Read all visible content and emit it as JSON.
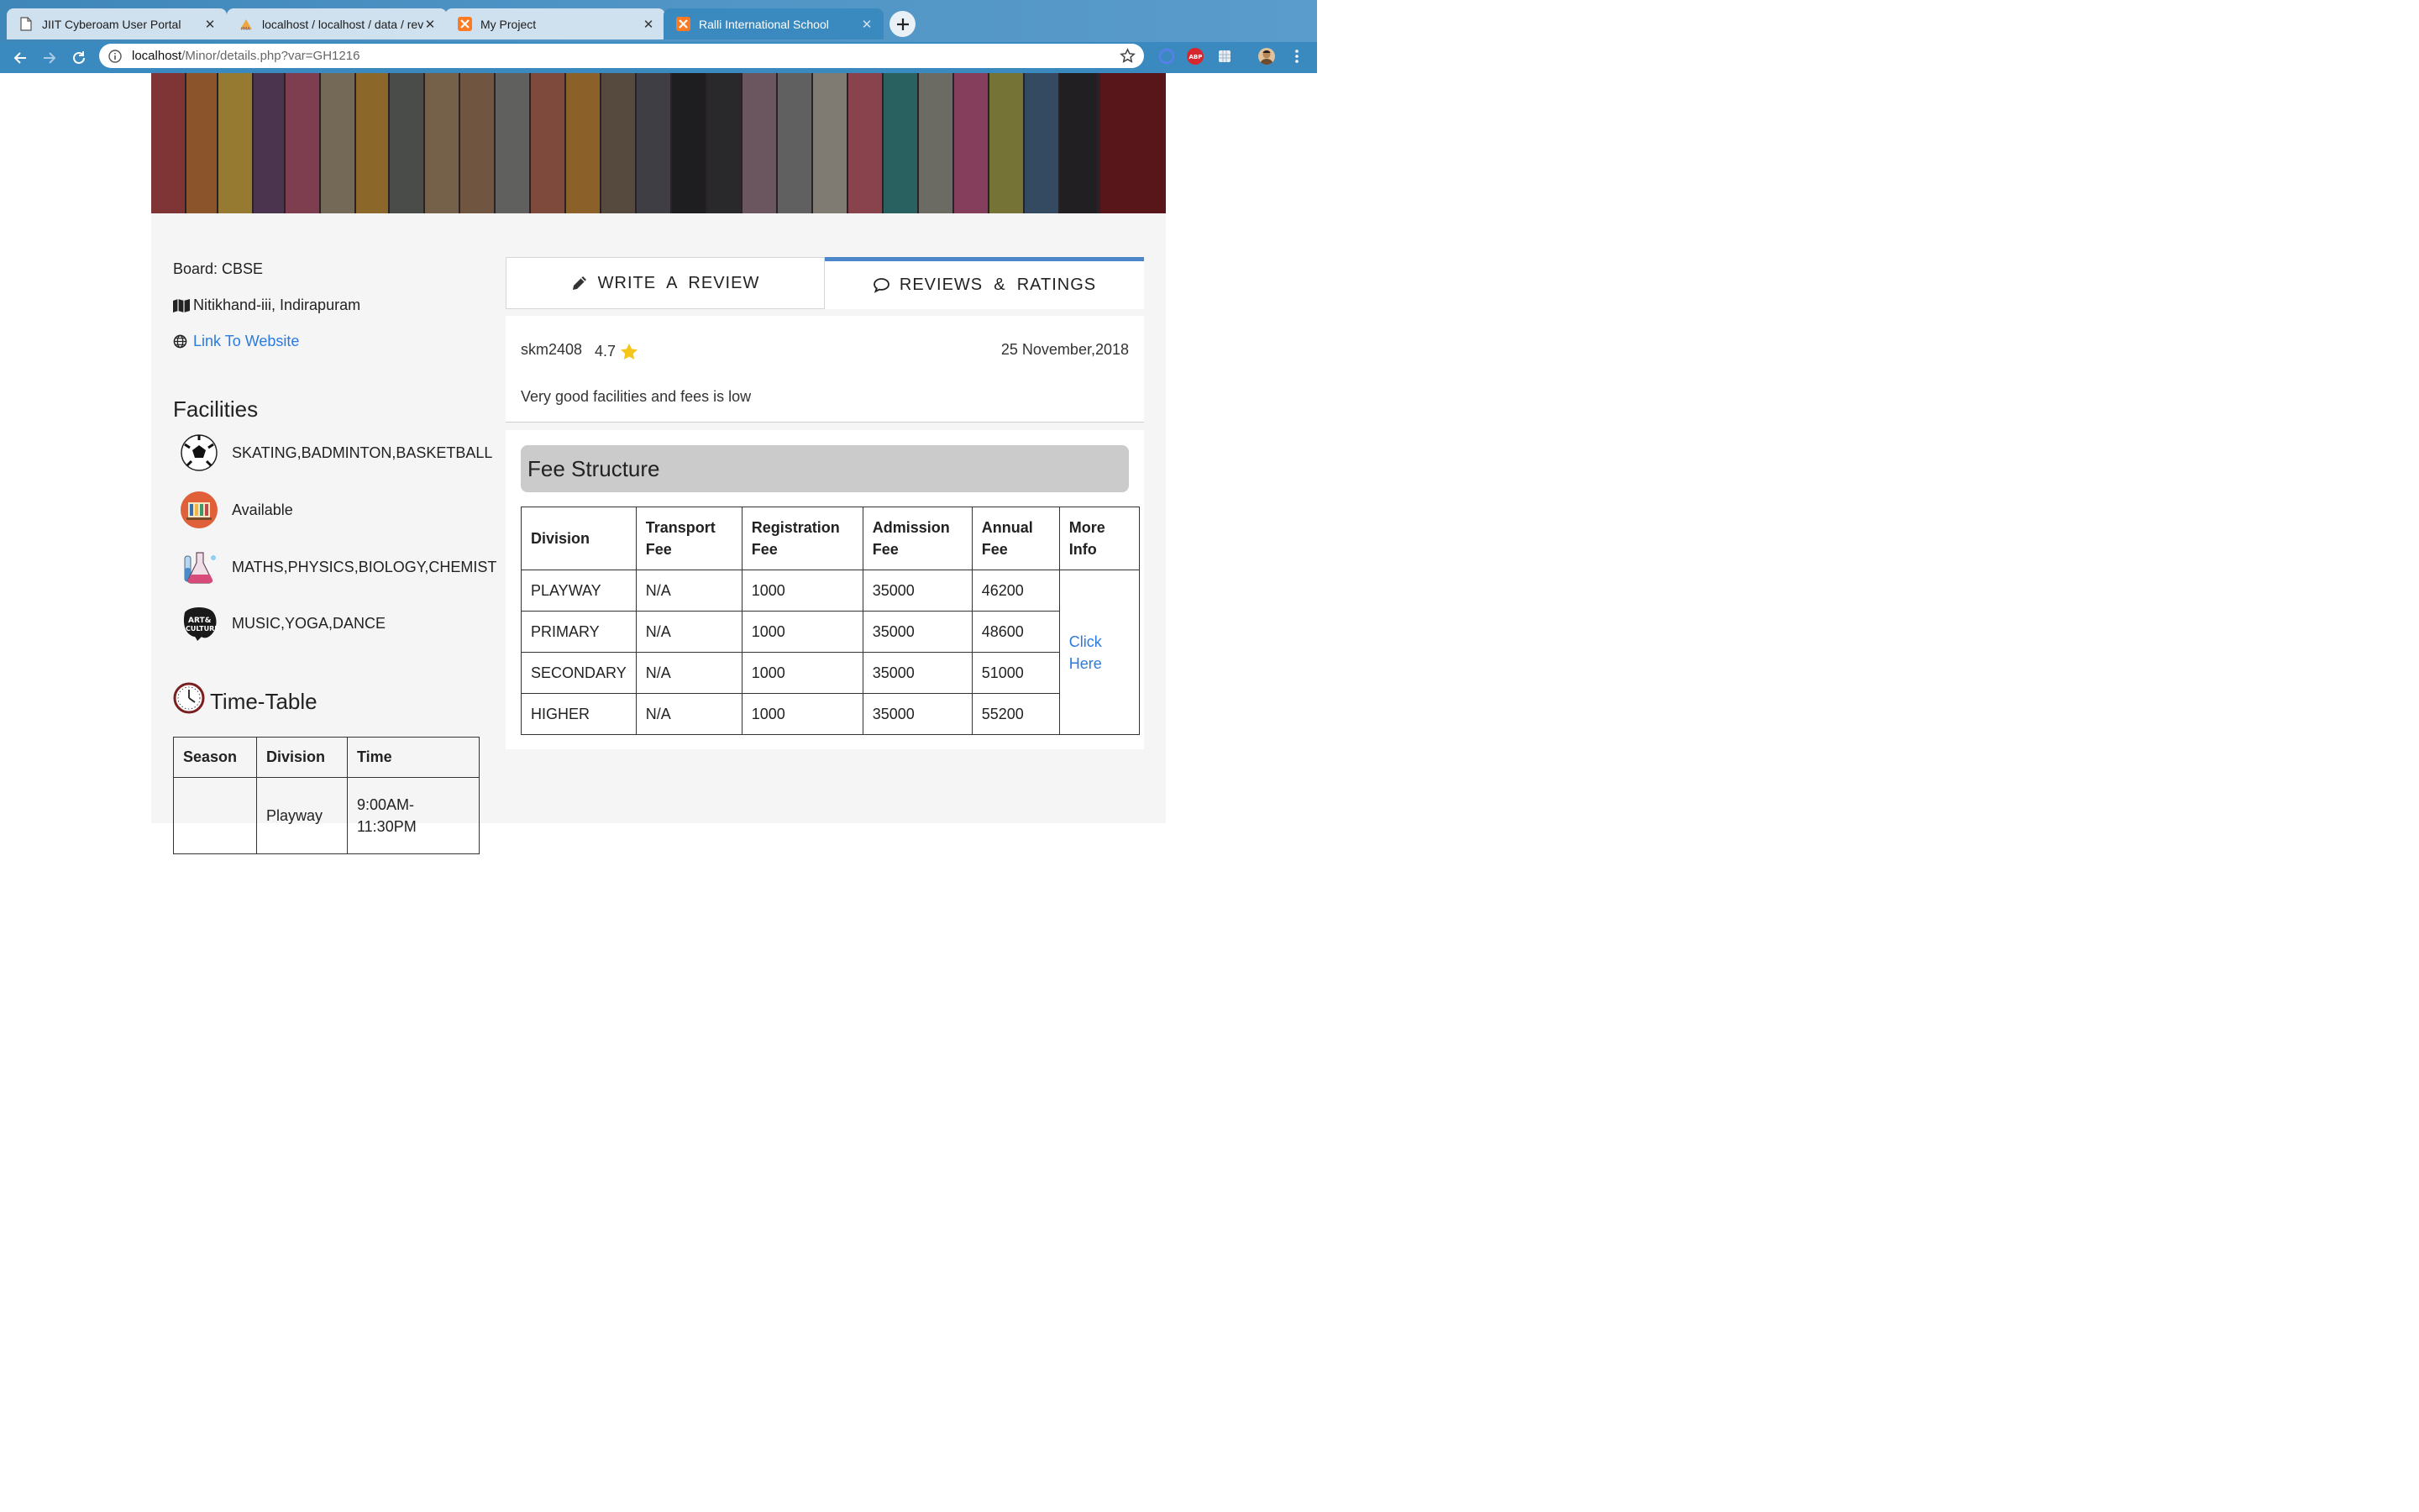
{
  "browser": {
    "tabs": [
      {
        "title": "JIIT Cyberoam User Portal",
        "icon": "document-icon"
      },
      {
        "title": "localhost / localhost / data / rev",
        "icon": "phpmyadmin-icon"
      },
      {
        "title": "My Project",
        "icon": "xampp-icon"
      },
      {
        "title": "Ralli International School",
        "icon": "xampp-icon",
        "active": true
      }
    ],
    "url_host": "localhost",
    "url_rest": "/Minor/details.php?var=GH1216"
  },
  "school": {
    "board": "Board: CBSE",
    "address": "Nitikhand-iii, Indirapuram",
    "website_link": "Link To Website"
  },
  "facilities": {
    "heading": "Facilities",
    "items": [
      {
        "icon": "football-icon",
        "text": "SKATING,BADMINTON,BASKETBALL"
      },
      {
        "icon": "library-icon",
        "text": "Available"
      },
      {
        "icon": "lab-flask-icon",
        "text": "MATHS,PHYSICS,BIOLOGY,CHEMIST"
      },
      {
        "icon": "art-culture-icon",
        "text": "MUSIC,YOGA,DANCE"
      }
    ]
  },
  "timetable": {
    "heading": "Time-Table",
    "headers": [
      "Season",
      "Division",
      "Time"
    ],
    "rows": [
      [
        "",
        "Playway",
        "9:00AM-11:30PM"
      ]
    ]
  },
  "review_tabs": {
    "write": "WRITE  A  REVIEW",
    "reviews": "REVIEWS  &  RATINGS"
  },
  "review": {
    "user": "skm2408",
    "rating": "4.7",
    "date": "25 November,2018",
    "text": "Very good facilities and fees is low"
  },
  "fees": {
    "heading": "Fee Structure",
    "headers": [
      "Division",
      "Transport Fee",
      "Registration Fee",
      "Admission Fee",
      "Annual Fee",
      "More Info"
    ],
    "rows": [
      [
        "PLAYWAY",
        "N/A",
        "1000",
        "35000",
        "46200"
      ],
      [
        "PRIMARY",
        "N/A",
        "1000",
        "35000",
        "48600"
      ],
      [
        "SECONDARY",
        "N/A",
        "1000",
        "35000",
        "51000"
      ],
      [
        "HIGHER",
        "N/A",
        "1000",
        "35000",
        "55200"
      ]
    ],
    "more_info_link": "Click Here"
  },
  "colors": {
    "link": "#2a7ae2",
    "active_tab_border": "#4a86c8",
    "chrome_blue": "#3a8ac0"
  }
}
